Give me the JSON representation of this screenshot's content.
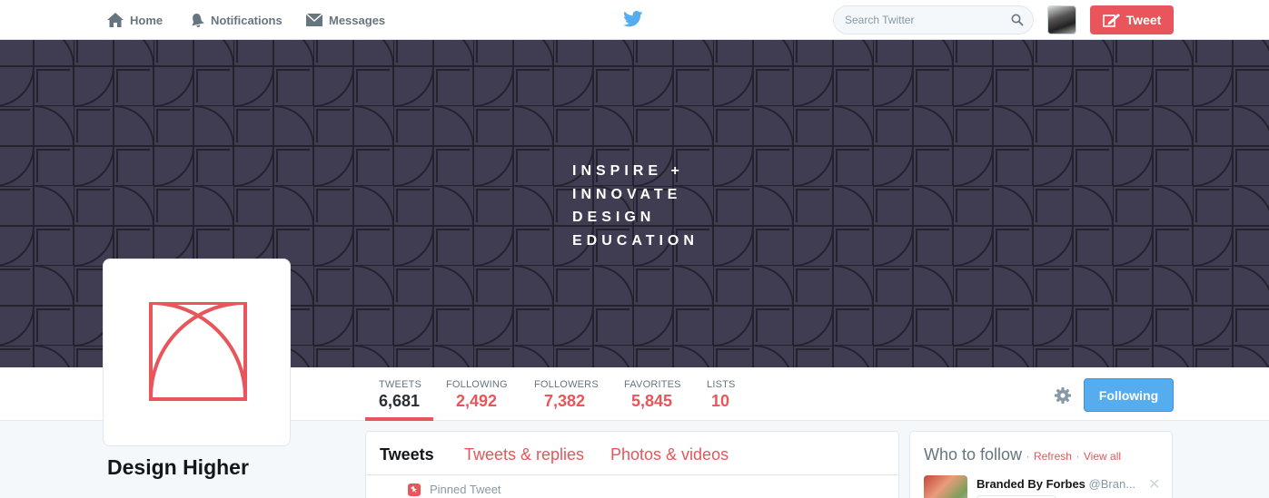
{
  "nav": {
    "home": "Home",
    "notifications": "Notifications",
    "messages": "Messages",
    "search_placeholder": "Search Twitter",
    "tweet": "Tweet"
  },
  "banner": {
    "lines": [
      "INSPIRE +",
      "INNOVATE",
      "DESIGN",
      "EDUCATION"
    ]
  },
  "profile": {
    "name": "Design Higher",
    "stats": [
      {
        "label": "TWEETS",
        "value": "6,681"
      },
      {
        "label": "FOLLOWING",
        "value": "2,492"
      },
      {
        "label": "FOLLOWERS",
        "value": "7,382"
      },
      {
        "label": "FAVORITES",
        "value": "5,845"
      },
      {
        "label": "LISTS",
        "value": "10"
      }
    ],
    "follow_button": "Following"
  },
  "timeline": {
    "tabs": [
      "Tweets",
      "Tweets & replies",
      "Photos & videos"
    ],
    "pinned": "Pinned Tweet"
  },
  "who_to_follow": {
    "title": "Who to follow",
    "sep": "·",
    "refresh": "Refresh",
    "view_all": "View all",
    "suggestion": {
      "name": "Branded By Forbes",
      "handle": "@Bran..."
    },
    "close": "✕"
  },
  "colors": {
    "accent": "#e8555a",
    "banner": "#403d52",
    "follow_blue": "#55acee",
    "bird": "#55acee"
  }
}
